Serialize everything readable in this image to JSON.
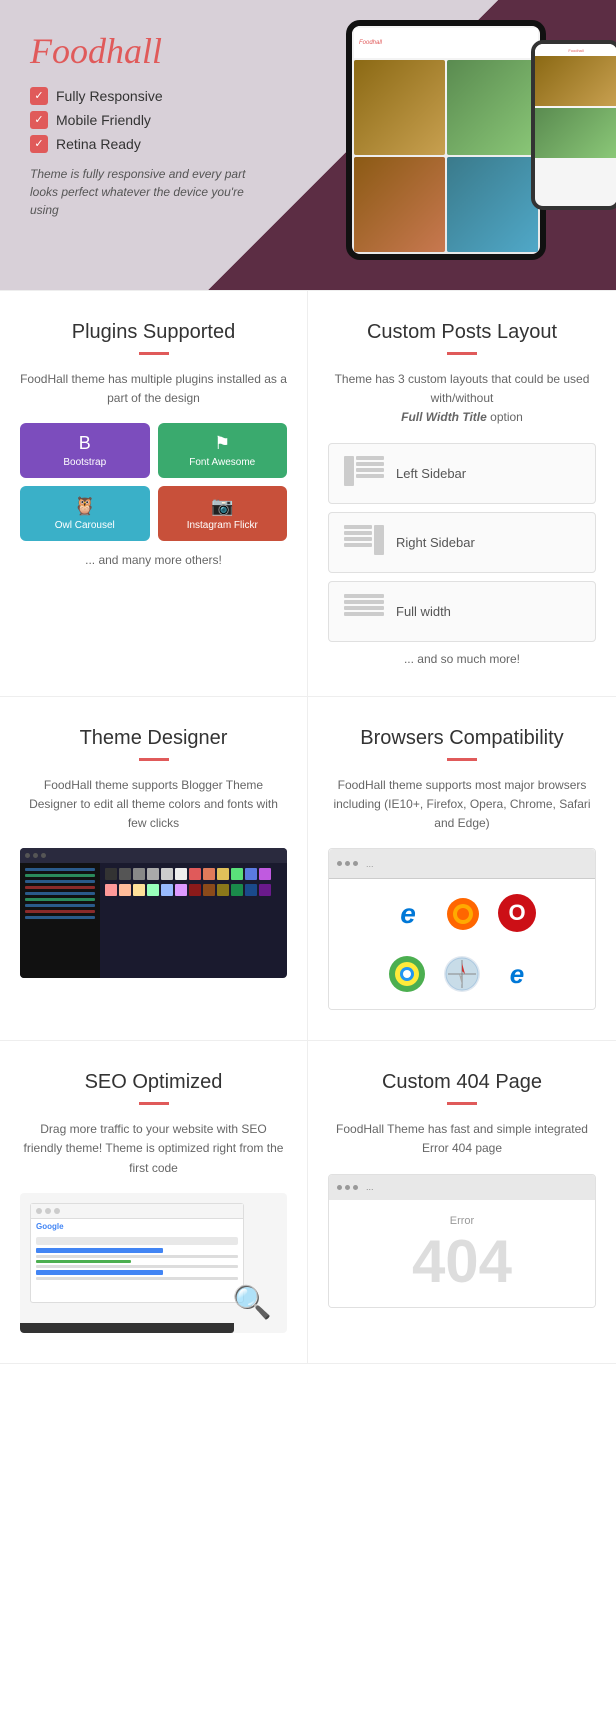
{
  "hero": {
    "logo": "Foodhall",
    "features": [
      "Fully Responsive",
      "Mobile Friendly",
      "Retina Ready"
    ],
    "description": "Theme is fully responsive and every part looks perfect whatever the device you're using"
  },
  "plugins": {
    "title": "Plugins Supported",
    "description": "FoodHall theme has multiple plugins installed as a part of the design",
    "items": [
      {
        "name": "Bootstrap",
        "icon": "B"
      },
      {
        "name": "Font Awesome",
        "icon": "⚑"
      },
      {
        "name": "Owl Carousel",
        "icon": "🦉"
      },
      {
        "name": "Instagram Flickr",
        "icon": "📷"
      }
    ],
    "more": "... and many more others!"
  },
  "custom_posts": {
    "title": "Custom Posts Layout",
    "description": "Theme has 3 custom layouts that could be used with/without",
    "bold_text": "Full Width Title",
    "after_bold": "option",
    "layouts": [
      {
        "name": "Left Sidebar"
      },
      {
        "name": "Right Sidebar"
      },
      {
        "name": "Full width"
      }
    ],
    "more": "... and so much more!"
  },
  "theme_designer": {
    "title": "Theme Designer",
    "description": "FoodHall theme supports Blogger Theme Designer to edit all theme colors and fonts with few clicks"
  },
  "browsers": {
    "title": "Browsers Compatibility",
    "description": "FoodHall theme supports most major browsers including (IE10+, Firefox, Opera, Chrome, Safari and Edge)",
    "dots": "...",
    "icons": [
      {
        "name": "Internet Explorer",
        "symbol": "e",
        "class": "bi-ie"
      },
      {
        "name": "Firefox",
        "symbol": "🦊",
        "class": "bi-ff"
      },
      {
        "name": "Opera",
        "symbol": "O",
        "class": "bi-opera"
      },
      {
        "name": "Chrome",
        "symbol": "◎",
        "class": "bi-chrome"
      },
      {
        "name": "Safari",
        "symbol": "◎",
        "class": "bi-safari"
      },
      {
        "name": "Edge",
        "symbol": "e",
        "class": "bi-edge"
      }
    ]
  },
  "seo": {
    "title": "SEO Optimized",
    "description": "Drag more traffic to your website with SEO friendly theme! Theme is optimized right from the first code"
  },
  "page404": {
    "title": "Custom 404 Page",
    "description": "FoodHall Theme has fast and simple integrated Error 404 page",
    "dots": "...",
    "error_label": "Error",
    "error_number": "404"
  },
  "colors": {
    "accent": "#e05a5a",
    "dark_bg": "#5c2d44",
    "light_bg": "#d8d0d8"
  }
}
